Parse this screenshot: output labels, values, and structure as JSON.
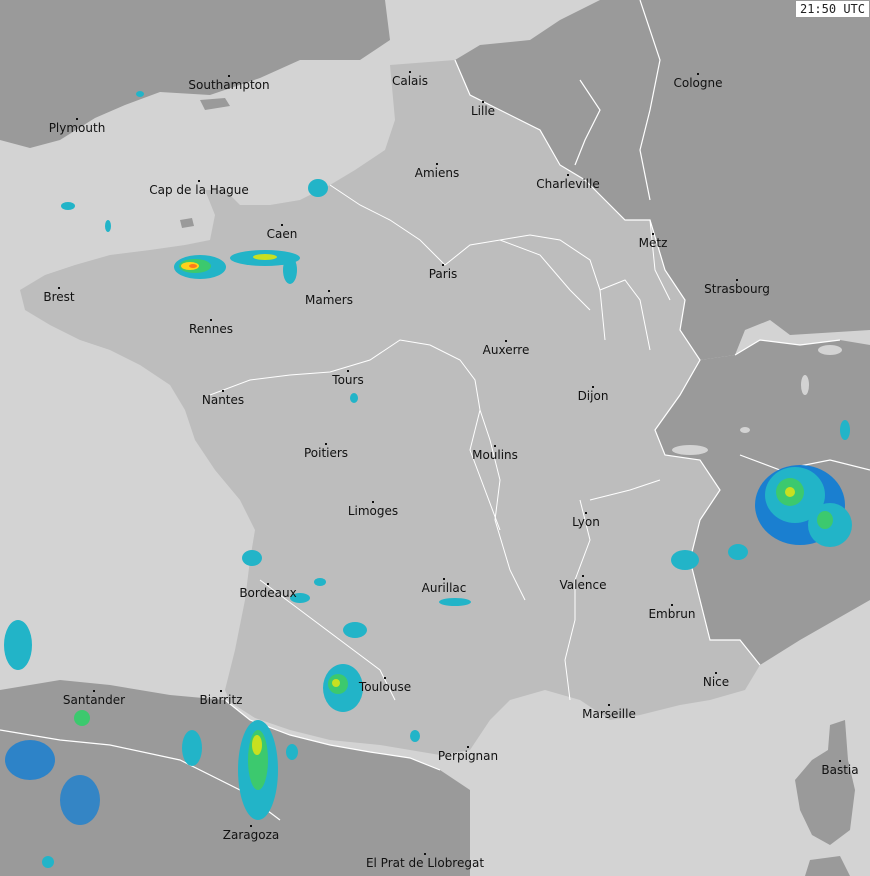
{
  "timestamp": "21:50 UTC",
  "colors": {
    "sea": "#d3d3d3",
    "france": "#bdbdbd",
    "neighbors": "#9a9a9a",
    "borders": "#ffffff",
    "rivers": "#ffffff"
  },
  "radar_scale_colors": [
    "#1a7fd0",
    "#22b4c8",
    "#3cc96e",
    "#c8e020",
    "#ffd21a",
    "#ff7a1a"
  ],
  "cities": [
    {
      "id": "southampton",
      "name": "Southampton"
    },
    {
      "id": "calais",
      "name": "Calais"
    },
    {
      "id": "cologne",
      "name": "Cologne"
    },
    {
      "id": "plymouth",
      "name": "Plymouth"
    },
    {
      "id": "lille",
      "name": "Lille"
    },
    {
      "id": "amiens",
      "name": "Amiens"
    },
    {
      "id": "charleville",
      "name": "Charleville"
    },
    {
      "id": "cap-de-la-hague",
      "name": "Cap de la Hague"
    },
    {
      "id": "caen",
      "name": "Caen"
    },
    {
      "id": "metz",
      "name": "Metz"
    },
    {
      "id": "paris",
      "name": "Paris"
    },
    {
      "id": "brest",
      "name": "Brest"
    },
    {
      "id": "strasbourg",
      "name": "Strasbourg"
    },
    {
      "id": "mamers",
      "name": "Mamers"
    },
    {
      "id": "rennes",
      "name": "Rennes"
    },
    {
      "id": "auxerre",
      "name": "Auxerre"
    },
    {
      "id": "tours",
      "name": "Tours"
    },
    {
      "id": "nantes",
      "name": "Nantes"
    },
    {
      "id": "dijon",
      "name": "Dijon"
    },
    {
      "id": "poitiers",
      "name": "Poitiers"
    },
    {
      "id": "moulins",
      "name": "Moulins"
    },
    {
      "id": "limoges",
      "name": "Limoges"
    },
    {
      "id": "lyon",
      "name": "Lyon"
    },
    {
      "id": "valence",
      "name": "Valence"
    },
    {
      "id": "aurillac",
      "name": "Aurillac"
    },
    {
      "id": "bordeaux",
      "name": "Bordeaux"
    },
    {
      "id": "embrun",
      "name": "Embrun"
    },
    {
      "id": "nice",
      "name": "Nice"
    },
    {
      "id": "santander",
      "name": "Santander"
    },
    {
      "id": "biarritz",
      "name": "Biarritz"
    },
    {
      "id": "toulouse",
      "name": "Toulouse"
    },
    {
      "id": "marseille",
      "name": "Marseille"
    },
    {
      "id": "perpignan",
      "name": "Perpignan"
    },
    {
      "id": "bastia",
      "name": "Bastia"
    },
    {
      "id": "zaragoza",
      "name": "Zaragoza"
    },
    {
      "id": "el-prat-de-llobregat",
      "name": "El Prat de Llobregat"
    }
  ]
}
